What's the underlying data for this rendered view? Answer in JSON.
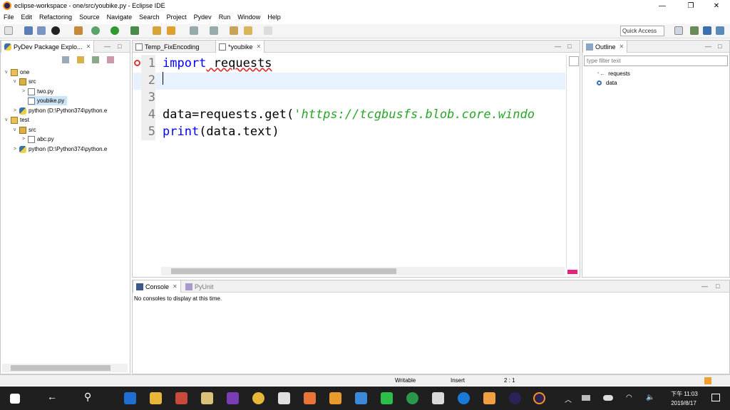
{
  "window": {
    "title": "eclipse-workspace - one/src/youbike.py - Eclipse IDE",
    "minimize": "—",
    "restore": "❐",
    "close": "✕"
  },
  "menu": [
    "File",
    "Edit",
    "Refactoring",
    "Source",
    "Navigate",
    "Search",
    "Project",
    "Pydev",
    "Run",
    "Window",
    "Help"
  ],
  "toolbar": {
    "quick_access": "Quick Access"
  },
  "explorer": {
    "tab_label": "PyDev Package Explo...",
    "tree": [
      {
        "label": "one",
        "twist": "v",
        "icon": "proj"
      },
      {
        "label": "src",
        "twist": "v",
        "icon": "src"
      },
      {
        "label": "two.py",
        "twist": ">",
        "icon": "py"
      },
      {
        "label": "youbike.py",
        "twist": "",
        "icon": "py"
      },
      {
        "label": "python  (D:\\Python374\\python.e",
        "twist": ">",
        "icon": "pyi"
      },
      {
        "label": "test",
        "twist": "v",
        "icon": "proj"
      },
      {
        "label": "src",
        "twist": "v",
        "icon": "src"
      },
      {
        "label": "abc.py",
        "twist": ">",
        "icon": "py"
      },
      {
        "label": "python  (D:\\Python374\\python.e",
        "twist": ">",
        "icon": "pyi"
      }
    ]
  },
  "editor": {
    "tabs": [
      {
        "label": "Temp_FixEncoding"
      },
      {
        "label": "*youbike"
      }
    ],
    "lines": [
      {
        "num": "1",
        "kw": "import",
        "rest": " requests",
        "str": "",
        "tail": ""
      },
      {
        "num": "2",
        "kw": "",
        "rest": "",
        "str": "",
        "tail": ""
      },
      {
        "num": "3",
        "kw": "",
        "rest": "",
        "str": "",
        "tail": ""
      },
      {
        "num": "4",
        "kw": "",
        "rest": "data=requests.get(",
        "str": "'https://tcgbusfs.blob.core.windo",
        "tail": ""
      },
      {
        "num": "5",
        "kw": "print",
        "rest": "(data.text)",
        "str": "",
        "tail": ""
      }
    ]
  },
  "outline": {
    "tab_label": "Outline",
    "filter_placeholder": "type filter text",
    "items": [
      "requests",
      "data"
    ]
  },
  "console": {
    "tabs": [
      {
        "label": "Console"
      },
      {
        "label": "PyUnit"
      }
    ],
    "message": "No consoles to display at this time."
  },
  "status": {
    "mode": "Writable",
    "insert": "Insert",
    "position": "2 : 1"
  },
  "taskbar": {
    "time": "下午 11:03",
    "date": "2019/8/17"
  }
}
